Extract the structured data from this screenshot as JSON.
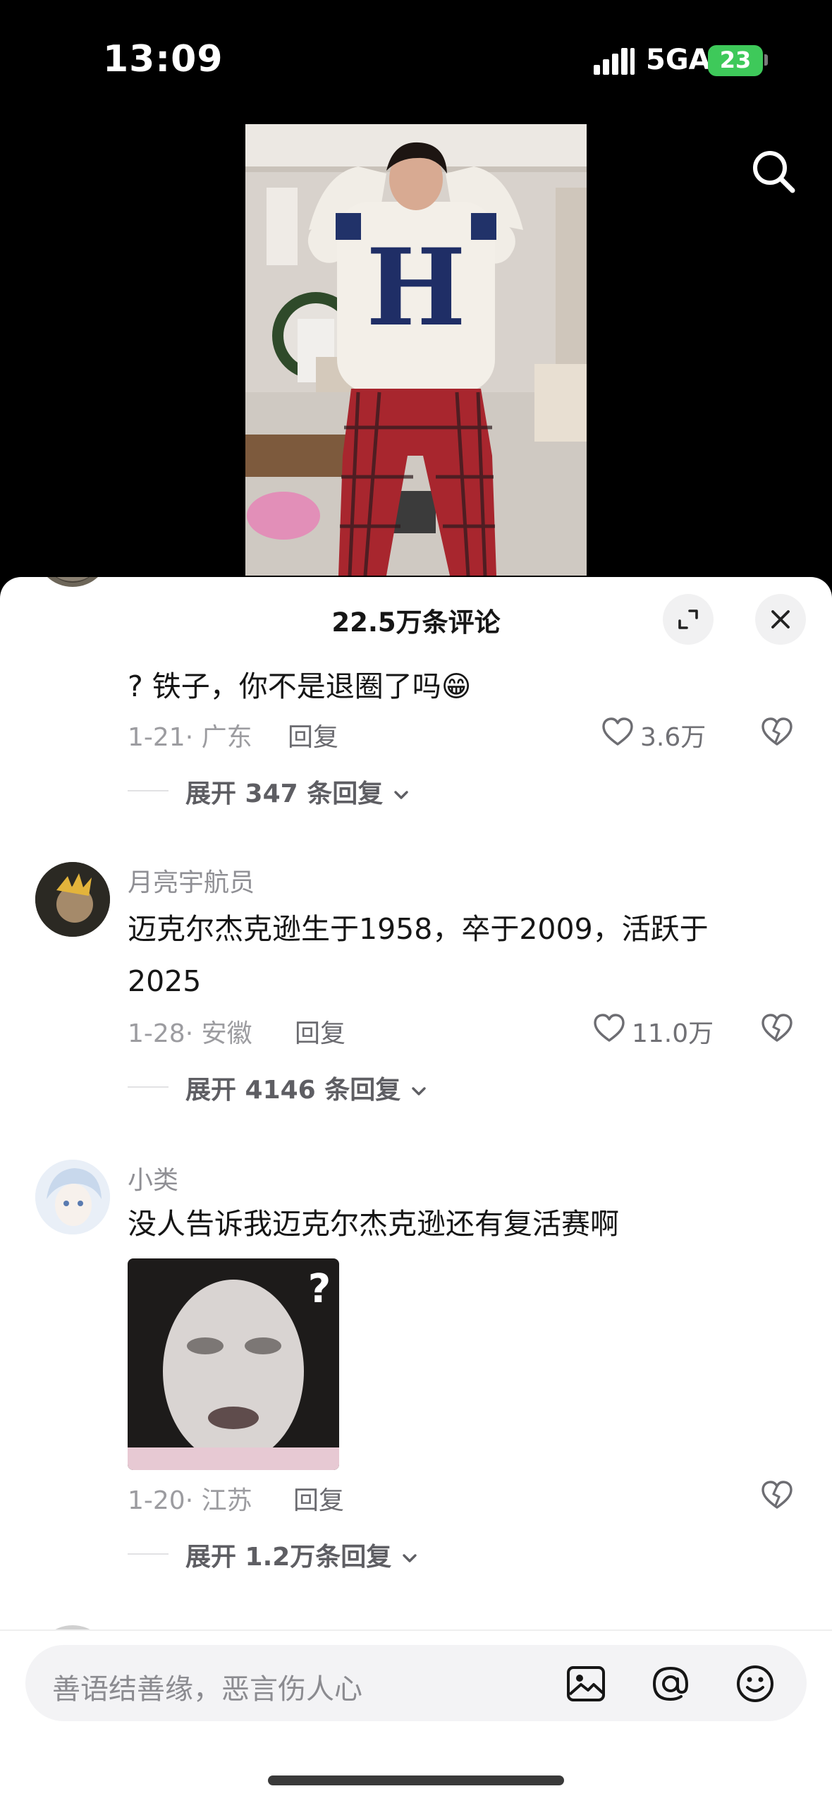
{
  "status_bar": {
    "time": "13:09",
    "network": "5GA",
    "battery": "23"
  },
  "video": {
    "sweater_letter": "H"
  },
  "comment_panel": {
    "title": "22.5万条评论"
  },
  "comments": [
    {
      "text": "? 铁子，你不是退圈了吗",
      "emoji": "😁",
      "meta": "1-21· 广东",
      "reply_label": "回复",
      "likes": "3.6万",
      "expand": "展开 347 条回复"
    },
    {
      "username": "月亮宇航员",
      "text_line1": "迈克尔杰克逊生于1958，卒于2009，活跃于",
      "text_line2": "2025",
      "meta": "1-28· 安徽",
      "reply_label": "回复",
      "likes": "11.0万",
      "expand": "展开 4146 条回复"
    },
    {
      "username": "小类",
      "text": "没人告诉我迈克尔杰克逊还有复活赛啊",
      "sticker_mark": "?",
      "meta": "1-20· 江苏",
      "reply_label": "回复",
      "expand": "展开 1.2万条回复"
    }
  ],
  "input": {
    "placeholder": "善语结善缘，恶言伤人心"
  },
  "icons": [
    "search-icon",
    "expand-icon",
    "close-icon",
    "heart-icon",
    "broken-heart-icon",
    "chevron-down-icon",
    "image-icon",
    "at-icon",
    "emoji-icon"
  ]
}
